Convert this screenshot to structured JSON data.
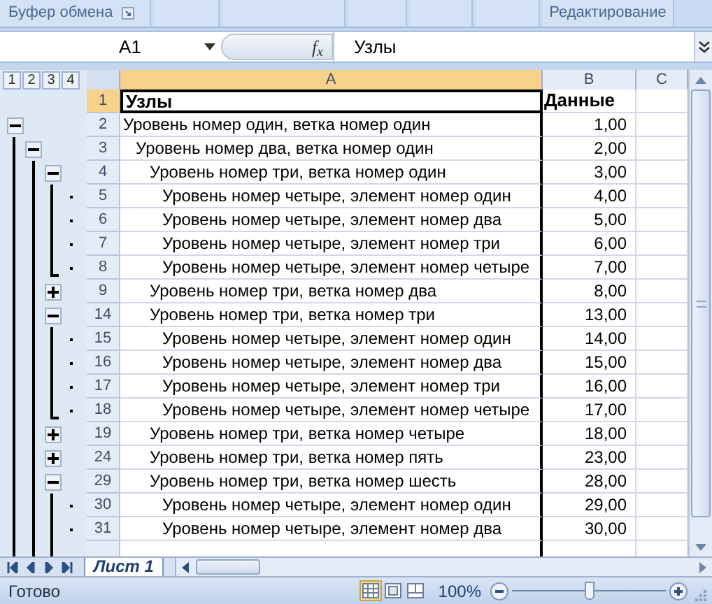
{
  "ribbon": {
    "left_group": "Буфер обмена",
    "right_group": "Редактирование"
  },
  "formula_bar": {
    "name_box": "A1",
    "fx": "f$_{x}$",
    "value": "Узлы"
  },
  "outline_levels": [
    "1",
    "2",
    "3",
    "4"
  ],
  "columns": [
    {
      "label": "A",
      "selected": true
    },
    {
      "label": "B",
      "selected": false
    },
    {
      "label": "C",
      "selected": false
    }
  ],
  "header_row": {
    "number": "1",
    "selected": true,
    "label": "Узлы",
    "value": "Данные"
  },
  "rows": [
    {
      "number": "2",
      "text": "Уровень номер один, ветка номер один",
      "value": "1,00",
      "expanded": true,
      "children": [
        {
          "number": "3",
          "text": "Уровень номер два, ветка номер один",
          "value": "2,00",
          "expanded": true,
          "children": [
            {
              "number": "4",
              "text": "Уровень номер три, ветка номер один",
              "value": "3,00",
              "expanded": true,
              "children": [
                {
                  "number": "5",
                  "text": "Уровень номер четыре, элемент номер один",
                  "value": "4,00"
                },
                {
                  "number": "6",
                  "text": "Уровень номер четыре, элемент номер два",
                  "value": "5,00"
                },
                {
                  "number": "7",
                  "text": "Уровень номер четыре, элемент номер три",
                  "value": "6,00"
                },
                {
                  "number": "8",
                  "text": "Уровень номер четыре, элемент номер четыре",
                  "value": "7,00"
                }
              ]
            },
            {
              "number": "9",
              "text": "Уровень номер три, ветка номер два",
              "value": "8,00",
              "expanded": false
            },
            {
              "number": "14",
              "text": "Уровень номер три, ветка номер три",
              "value": "13,00",
              "expanded": true,
              "children": [
                {
                  "number": "15",
                  "text": "Уровень номер четыре, элемент номер один",
                  "value": "14,00"
                },
                {
                  "number": "16",
                  "text": "Уровень номер четыре, элемент номер два",
                  "value": "15,00"
                },
                {
                  "number": "17",
                  "text": "Уровень номер четыре, элемент номер три",
                  "value": "16,00"
                },
                {
                  "number": "18",
                  "text": "Уровень номер четыре, элемент номер четыре",
                  "value": "17,00"
                }
              ]
            },
            {
              "number": "19",
              "text": "Уровень номер три, ветка номер четыре",
              "value": "18,00",
              "expanded": false
            },
            {
              "number": "24",
              "text": "Уровень номер три, ветка номер пять",
              "value": "23,00",
              "expanded": false
            },
            {
              "number": "29",
              "text": "Уровень номер три, ветка номер шесть",
              "value": "28,00",
              "expanded": true,
              "children": [
                {
                  "number": "30",
                  "text": "Уровень номер четыре, элемент номер один",
                  "value": "29,00"
                },
                {
                  "number": "31",
                  "text": "Уровень номер четыре, элемент номер два",
                  "value": "30,00"
                }
              ]
            }
          ]
        }
      ]
    }
  ],
  "sheet_tabs": [
    {
      "label": "Лист 1",
      "selected": true
    }
  ],
  "status_bar": {
    "text": "Готово",
    "views": [
      {
        "kind": "normal",
        "selected": true
      },
      {
        "kind": "layout",
        "selected": false
      },
      {
        "kind": "page_break",
        "selected": false
      }
    ],
    "zoom": "100%",
    "zoom_slider": {
      "level": 0.5
    }
  }
}
